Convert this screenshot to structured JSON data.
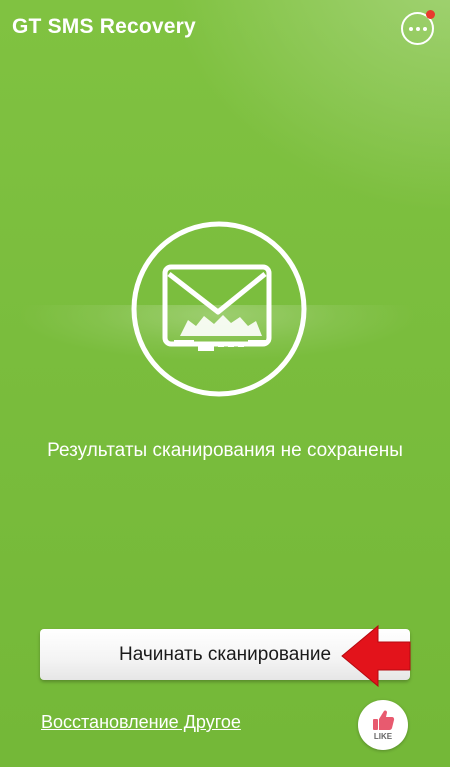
{
  "app": {
    "title": "GT SMS Recovery"
  },
  "header": {
    "menu_icon": "more-dots-icon",
    "has_notification": true
  },
  "main": {
    "illustration_icon": "broken-envelope-icon",
    "status_text": "Результаты сканирования не сохранены"
  },
  "actions": {
    "scan_button_label": "Начинать сканирование",
    "restore_link_label": "Восстановление Другое",
    "like_label": "LIKE",
    "like_icon": "thumbs-up-icon",
    "pointer_icon": "red-arrow-icon"
  },
  "colors": {
    "background": "#7cbf3f",
    "notification": "#e8392d",
    "arrow": "#e3131b",
    "like_icon": "#e85a6f"
  }
}
